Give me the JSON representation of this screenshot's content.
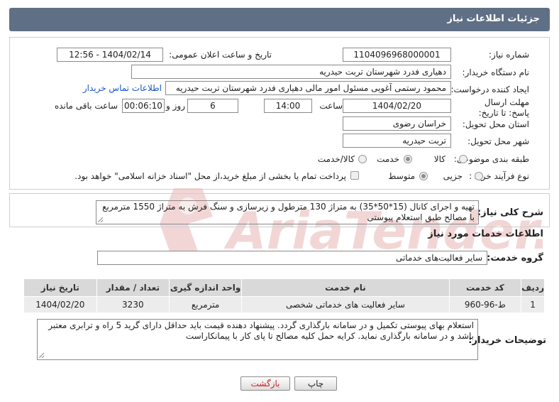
{
  "header": {
    "title": "جزئیات اطلاعات نیاز"
  },
  "form": {
    "need_number_label": "شماره نیاز:",
    "need_number": "1104096968000001",
    "announce_label": "تاریخ و ساعت اعلان عمومی:",
    "announce_value": "1404/02/14 - 12:56",
    "buyer_org_label": "نام دستگاه خریدار:",
    "buyer_org": "دهیاری فدرد  شهرستان تربت حیدریه",
    "creator_label": "ایجاد کننده درخواست:",
    "creator": "محمود رستمی آغویی مسئول امور مالی  دهیاری فدرد  شهرستان تربت حیدریه",
    "contact_link": "اطلاعات تماس خریدار",
    "deadline_label": "مهلت ارسال پاسخ: تا تاریخ:",
    "deadline_date": "1404/02/20",
    "time_label": "ساعت",
    "deadline_time": "14:00",
    "days_value": "6",
    "days_label": "روز و",
    "remaining_time": "00:06:10",
    "remaining_label": "ساعت باقی مانده",
    "province_label": "استان محل تحویل:",
    "province": "خراسان رضوی",
    "city_label": "شهر محل تحویل:",
    "city": "تربت حیدریه",
    "category_label": "طبقه بندی موضوعی:",
    "category_options": [
      "کالا",
      "خدمت",
      "کالا/خدمت"
    ],
    "category_selected": 1,
    "process_label": "نوع فرآیند خرید :",
    "process_options": [
      "جزیی",
      "متوسط"
    ],
    "process_selected": 1,
    "payment_note": "پرداخت تمام یا بخشی از مبلغ خرید،از محل \"اسناد خزانه اسلامی\" خواهد بود."
  },
  "summary": {
    "label": "شرح کلی نیاز:",
    "text": "تهیه و اجرای کانال (15*50*35) به متراژ 130 مترطول و زیرسازی و سنگ فرش به متراژ 1550 مترمربع با مصالح طبق استعلام پیوستی"
  },
  "services": {
    "section_title": "اطلاعات خدمات مورد نیاز",
    "group_label": "گروه خدمت:",
    "group_value": "سایر فعالیت‌های خدماتی",
    "columns": [
      "ردیف",
      "کد خدمت",
      "نام خدمت",
      "واحد اندازه گیری",
      "تعداد / مقدار",
      "تاریخ نیاز"
    ],
    "rows": [
      [
        "1",
        "ط-96-960",
        "سایر فعالیت های خدماتی شخصی",
        "مترمربع",
        "3230",
        "1404/02/20"
      ]
    ]
  },
  "buyer_notes": {
    "label": "توضیحات خریدار:",
    "text": "استعلام بهای پیوستی تکمیل و در سامانه بارگذاری گردد. پیشنهاد دهنده قیمت باید حداقل دارای گرید 5 راه و ترابری معتبر باشد و در سامانه بارگذاری نماید. کرایه حمل کلیه مصالح تا پای کار با پیمانکاراست"
  },
  "buttons": {
    "print": "چاپ",
    "back": "بازگشت"
  },
  "watermark": {
    "text": "AriaTender.neT"
  },
  "colors": {
    "header_bg": "#5f6f86",
    "link": "#1a56c4",
    "watermark": "#e8b5b5",
    "back_text": "#cc2222"
  }
}
